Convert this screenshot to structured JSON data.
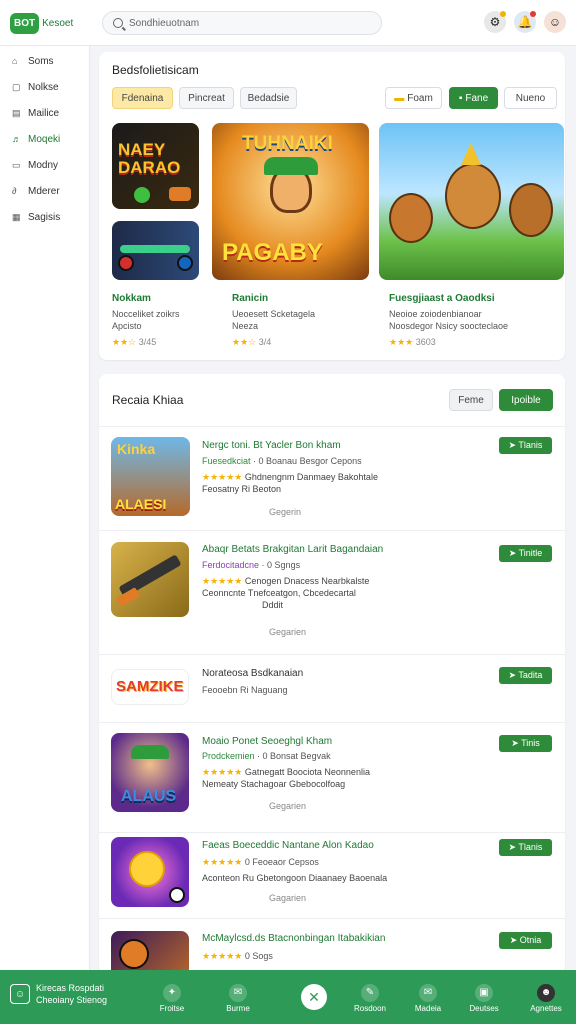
{
  "topbar": {
    "logo_badge": "BOT",
    "logo_text": "Kesoet",
    "search_placeholder": "Sondhieuotnam"
  },
  "sidebar": {
    "items": [
      {
        "label": "Soms",
        "icon": "home-icon"
      },
      {
        "label": "Nolkse",
        "icon": "apps-icon"
      },
      {
        "label": "Mailice",
        "icon": "calendar-icon"
      },
      {
        "label": "Moqeki",
        "icon": "gamepad-icon",
        "active": true
      },
      {
        "label": "Modny",
        "icon": "book-icon"
      },
      {
        "label": "Mderer",
        "icon": "link-icon"
      },
      {
        "label": "Sagisis",
        "icon": "table-icon"
      }
    ]
  },
  "featured": {
    "title": "Bedsfolietisicam",
    "chips": [
      "Fdenaina",
      "Pincreat",
      "Bedadsie"
    ],
    "filter_button": "Foam",
    "green_button": "Fane",
    "outline_button": "Nueno",
    "cards": [
      {
        "name": "Nokkam",
        "desc": [
          "Nocceliket zoikrs",
          "Apcisto"
        ],
        "stars": "★★☆",
        "rating": "3/45",
        "art_text": "NAEY DARAO"
      },
      {
        "name": "Ranicin",
        "desc": [
          "Ueoesett Scketagela",
          "Neeza"
        ],
        "stars": "★★☆",
        "rating": "3/4",
        "art_text": "PAGABY"
      },
      {
        "name": "Fuesgjiaast a Oaodksi",
        "desc": [
          "Neoioe zoiodenbianoar",
          "Noosdegor Nsicy soocteclaoe"
        ],
        "stars": "★★★",
        "rating": "3603"
      }
    ]
  },
  "list": {
    "title": "Recaia Khiaa",
    "btn_outline": "Feme",
    "btn_green": "Ipoible",
    "items": [
      {
        "name": "Nergc toni. Bt Yacler Bon kham",
        "category": "Fuesedkciat",
        "stars": "★★★★★",
        "rating": "0 Boanau Besgor Cepons",
        "desc": [
          "Ghdnengnm Danmaey Bakohtale",
          "Feosatny Ri Beoton"
        ],
        "publisher": "Gegerin",
        "action": "➤ Tlanis",
        "art_text": "ALAESI"
      },
      {
        "name": "Abaqr Betats Brakgitan Larit Bagandaian",
        "category": "Ferdocitadcne",
        "category_color": "purple",
        "stars": "★★★★★",
        "rating": "0 Sgngs",
        "desc": [
          "Cenogen Dnacess Nearbkalste",
          "Ceonncnte Tnefceatgon, Cbcedecartal",
          "Dddit"
        ],
        "publisher": "Gegarien",
        "action": "➤ Tinitle"
      },
      {
        "name": "Norateosa Bsdkanaian",
        "dark": true,
        "meta": "Feooebn Ri Naguang",
        "action": "➤ Tadita",
        "art_text": "SAMZIKE"
      },
      {
        "name": "Moaio Ponet Seoeghgl Kham",
        "category": "Prodckemien",
        "stars": "★★★★★",
        "rating": "0 Bonsat Begvak",
        "desc": [
          "Gatnegatt Boociota Neonnenlia",
          "Nemeaty Stachagoar Gbebocolfoag"
        ],
        "publisher": "Gegarien",
        "action": "➤ Tinis",
        "art_text": "ALAUS"
      },
      {
        "name": "Faeas Boeceddic Nantane Alon Kadao",
        "stars": "★★★★★",
        "rating": "0 Feoeaor Cepsos",
        "desc": [
          "Aconteon Ru Gbetongoon Diaanaey Baoenala"
        ],
        "publisher": "Gagarien",
        "action": "➤ Tlanis"
      },
      {
        "name": "McMaylcsd.ds Btacnonbingan Itabakikian",
        "stars": "★★★★★",
        "rating": "0 Sogs",
        "action": "➤ Otnia"
      }
    ]
  },
  "bottom": {
    "user_line1": "Kirecas Rospdati",
    "user_line2": "Cheoiany Stienog",
    "nav": [
      {
        "label": "Froitse",
        "icon": "gift-icon"
      },
      {
        "label": "Burme",
        "icon": "chat-icon"
      },
      {
        "label": "",
        "icon": "tools-icon",
        "big": true
      },
      {
        "label": "Rosdoon",
        "icon": "pen-icon"
      },
      {
        "label": "Madeia",
        "icon": "mail-icon"
      },
      {
        "label": "Deutses",
        "icon": "folder-icon"
      },
      {
        "label": "Agnettes",
        "icon": "avatar-icon"
      }
    ]
  },
  "colors": {
    "accent": "#2e8b3a",
    "bottom_bar": "#2d9a58",
    "chip_selected": "#fde9a6"
  }
}
